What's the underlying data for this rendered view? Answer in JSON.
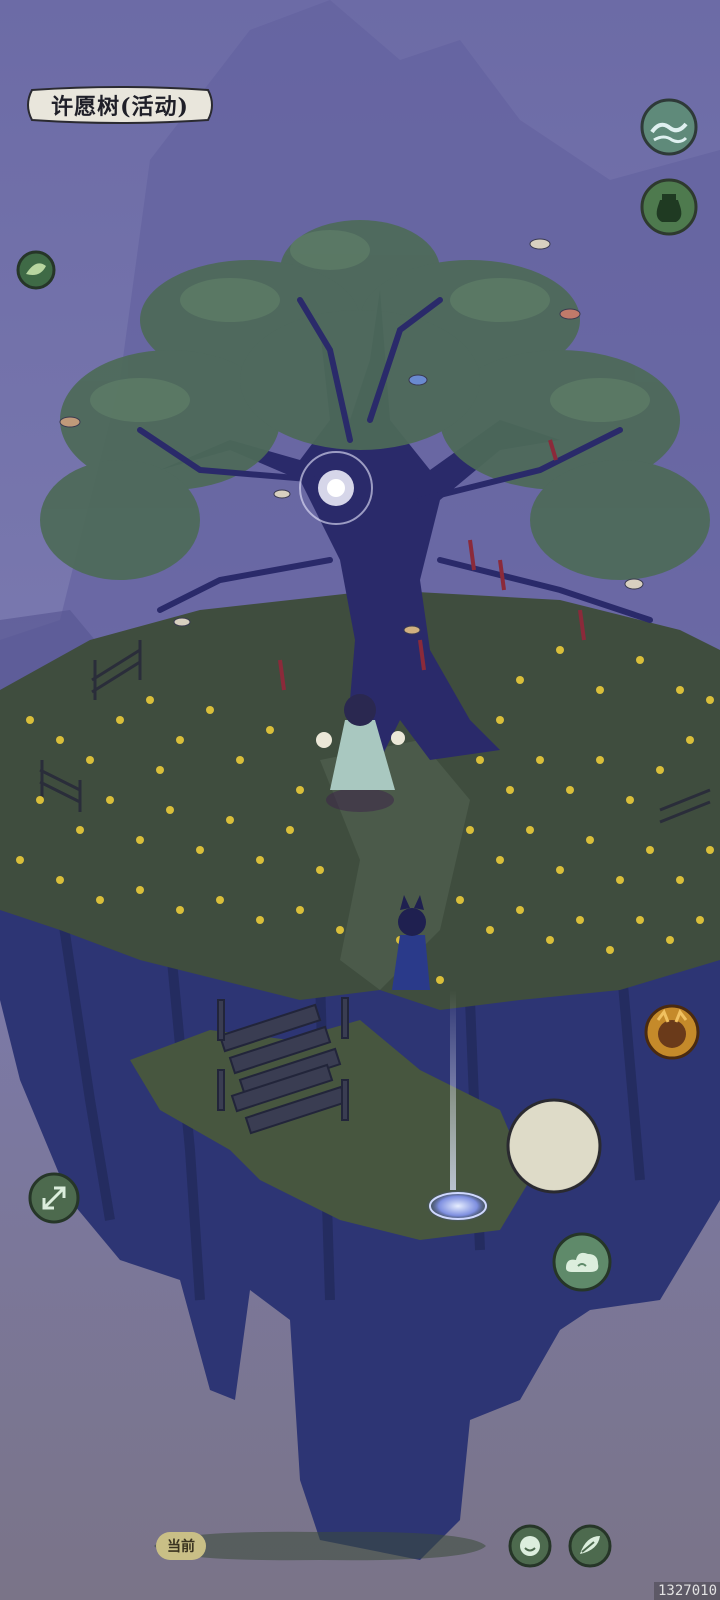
{
  "location": {
    "title": "许愿树(活动)"
  },
  "chat": {
    "tag_label": "当前"
  },
  "overlay": {
    "build_id": "1327010"
  },
  "hud": {
    "top_right_icons": [
      "wave-icon",
      "jar-icon"
    ],
    "left_icons": [
      "leaf-icon",
      "expand-icon"
    ],
    "right_icons": [
      "pet-face-icon",
      "cloud-icon"
    ],
    "bottom_icons": [
      "smile-icon",
      "leaf-action-icon"
    ]
  }
}
